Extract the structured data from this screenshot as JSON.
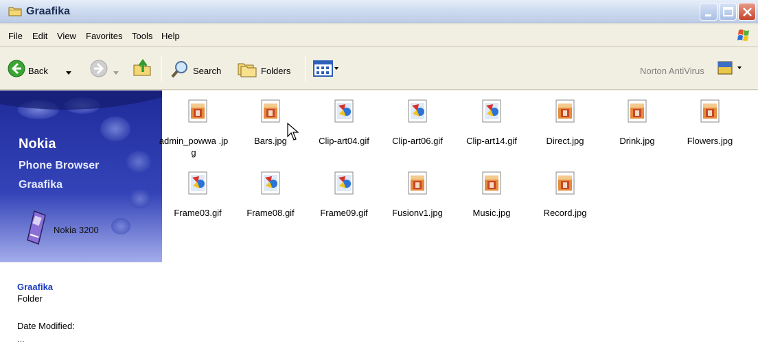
{
  "window": {
    "title": "Graafika",
    "colors": {
      "titlebar": "#cfdcf0",
      "close": "#c6432b",
      "pane": "#2f3fb6"
    }
  },
  "menu": {
    "items": [
      "File",
      "Edit",
      "View",
      "Favorites",
      "Tools",
      "Help"
    ]
  },
  "toolbar": {
    "back_label": "Back",
    "search_label": "Search",
    "folders_label": "Folders",
    "norton_label": "Norton AntiVirus",
    "icons": [
      "back-arrow-icon",
      "forward-arrow-icon",
      "up-folder-icon",
      "search-icon",
      "folders-icon",
      "views-icon",
      "norton-icon"
    ]
  },
  "leftpane": {
    "brand": "Nokia",
    "subtitle1": "Phone Browser",
    "subtitle2": "Graafika",
    "device": "Nokia 3200",
    "details": {
      "name": "Graafika",
      "type": "Folder",
      "date_label": "Date Modified:",
      "date_value": "..."
    }
  },
  "files": [
    {
      "name": "admin_powwa .jpg",
      "kind": "jpg"
    },
    {
      "name": "Bars.jpg",
      "kind": "jpg"
    },
    {
      "name": "Clip-art04.gif",
      "kind": "gif"
    },
    {
      "name": "Clip-art06.gif",
      "kind": "gif"
    },
    {
      "name": "Clip-art14.gif",
      "kind": "gif"
    },
    {
      "name": "Direct.jpg",
      "kind": "jpg"
    },
    {
      "name": "Drink.jpg",
      "kind": "jpg"
    },
    {
      "name": "Flowers.jpg",
      "kind": "jpg"
    },
    {
      "name": "Frame03.gif",
      "kind": "gif"
    },
    {
      "name": "Frame08.gif",
      "kind": "gif"
    },
    {
      "name": "Frame09.gif",
      "kind": "gif"
    },
    {
      "name": "Fusionv1.jpg",
      "kind": "jpg"
    },
    {
      "name": "Music.jpg",
      "kind": "jpg"
    },
    {
      "name": "Record.jpg",
      "kind": "jpg"
    }
  ]
}
